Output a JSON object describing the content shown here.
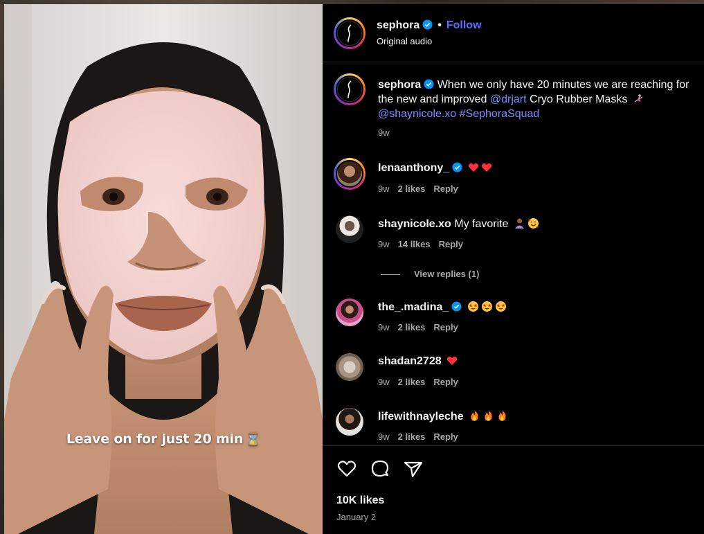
{
  "video": {
    "overlay_text": "Leave on for just 20 min",
    "overlay_icon": "hourglass-icon"
  },
  "header": {
    "username": "sephora",
    "separator": "•",
    "follow_label": "Follow",
    "audio_label": "Original audio"
  },
  "caption": {
    "username": "sephora",
    "text_before": "When we only have 20 minutes we are reaching for the new and improved ",
    "mention_1": "@drjart",
    "text_middle": " Cryo Rubber Masks ",
    "mention_2": "@shaynicole.xo",
    "hashtag": "#SephoraSquad",
    "age": "9w"
  },
  "comments": [
    {
      "username": "lenaanthony_",
      "verified": true,
      "text": "",
      "emojis": [
        "heart",
        "heart"
      ],
      "age": "9w",
      "likes": "2 likes",
      "reply": "Reply"
    },
    {
      "username": "shaynicole.xo",
      "verified": false,
      "text": "My favorite",
      "emojis": [
        "person",
        "smiling-face-with-hearts"
      ],
      "age": "9w",
      "likes": "14 likes",
      "reply": "Reply"
    },
    {
      "username": "the_.madina_",
      "verified": true,
      "text": "",
      "emojis": [
        "star-struck",
        "star-struck",
        "star-struck"
      ],
      "age": "9w",
      "likes": "2 likes",
      "reply": "Reply"
    },
    {
      "username": "shadan2728",
      "verified": false,
      "text": "",
      "emojis": [
        "heart"
      ],
      "age": "9w",
      "likes": "2 likes",
      "reply": "Reply"
    },
    {
      "username": "lifewithnayleche",
      "verified": false,
      "text": "",
      "emojis": [
        "fire",
        "fire",
        "fire"
      ],
      "age": "9w",
      "likes": "2 likes",
      "reply": "Reply"
    }
  ],
  "view_replies": "View replies (1)",
  "footer": {
    "likes": "10K likes",
    "date": "January 2"
  },
  "colors": {
    "background": "#000000",
    "link": "#7b8cff",
    "follow": "#5b6bff",
    "verified": "#0095f6",
    "muted": "#a8a8a8",
    "heart": "#ff3040"
  }
}
